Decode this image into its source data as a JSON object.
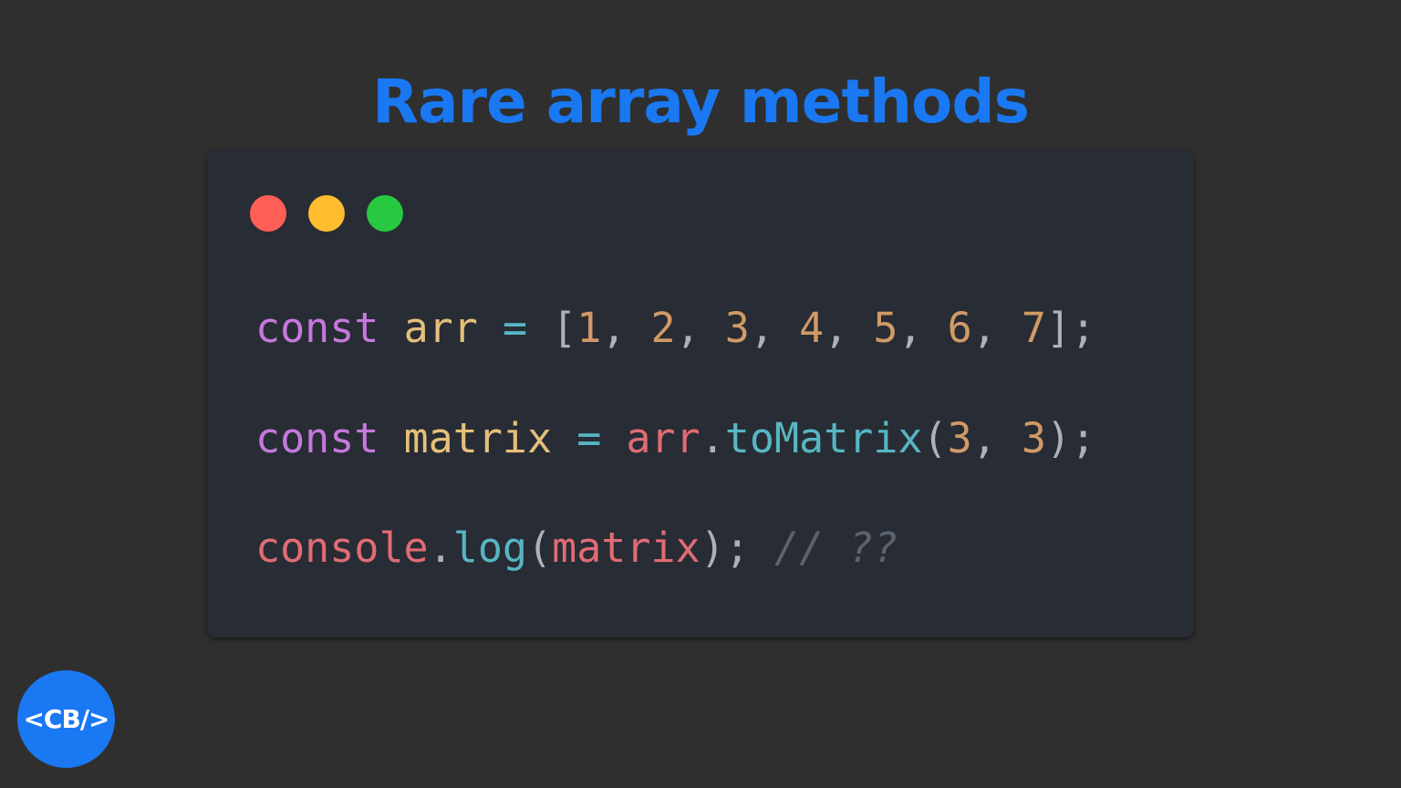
{
  "title": "Rare array methods",
  "logo": {
    "text": "<CB/>"
  },
  "window_controls": [
    "close",
    "minimize",
    "maximize"
  ],
  "code": {
    "lines": [
      [
        {
          "text": "const",
          "token": "keyword"
        },
        {
          "text": " ",
          "token": "plain"
        },
        {
          "text": "arr",
          "token": "variable"
        },
        {
          "text": " ",
          "token": "plain"
        },
        {
          "text": "=",
          "token": "operator"
        },
        {
          "text": " ",
          "token": "plain"
        },
        {
          "text": "[",
          "token": "punct"
        },
        {
          "text": "1",
          "token": "number"
        },
        {
          "text": ", ",
          "token": "punct"
        },
        {
          "text": "2",
          "token": "number"
        },
        {
          "text": ", ",
          "token": "punct"
        },
        {
          "text": "3",
          "token": "number"
        },
        {
          "text": ", ",
          "token": "punct"
        },
        {
          "text": "4",
          "token": "number"
        },
        {
          "text": ", ",
          "token": "punct"
        },
        {
          "text": "5",
          "token": "number"
        },
        {
          "text": ", ",
          "token": "punct"
        },
        {
          "text": "6",
          "token": "number"
        },
        {
          "text": ", ",
          "token": "punct"
        },
        {
          "text": "7",
          "token": "number"
        },
        {
          "text": "];",
          "token": "punct"
        }
      ],
      [
        {
          "text": "const",
          "token": "keyword"
        },
        {
          "text": " ",
          "token": "plain"
        },
        {
          "text": "matrix",
          "token": "variable"
        },
        {
          "text": " ",
          "token": "plain"
        },
        {
          "text": "=",
          "token": "operator"
        },
        {
          "text": " ",
          "token": "plain"
        },
        {
          "text": "arr",
          "token": "object"
        },
        {
          "text": ".",
          "token": "punct"
        },
        {
          "text": "toMatrix",
          "token": "method"
        },
        {
          "text": "(",
          "token": "punct"
        },
        {
          "text": "3",
          "token": "number"
        },
        {
          "text": ", ",
          "token": "punct"
        },
        {
          "text": "3",
          "token": "number"
        },
        {
          "text": ");",
          "token": "punct"
        }
      ],
      [
        {
          "text": "console",
          "token": "object"
        },
        {
          "text": ".",
          "token": "punct"
        },
        {
          "text": "log",
          "token": "method"
        },
        {
          "text": "(",
          "token": "punct"
        },
        {
          "text": "matrix",
          "token": "object"
        },
        {
          "text": ");",
          "token": "punct"
        },
        {
          "text": " ",
          "token": "plain"
        },
        {
          "text": "// ??",
          "token": "comment"
        }
      ]
    ]
  },
  "colors": {
    "background": "#2f2f2f",
    "window_bg": "#282c34",
    "title": "#1a78f2",
    "dot_red": "#ff5f57",
    "dot_yellow": "#febc2e",
    "dot_green": "#28c840",
    "logo_bg": "#1a78f2",
    "logo_text": "#ffffff",
    "keyword": "#c678dd",
    "variable": "#e5c07b",
    "operator": "#56b6c2",
    "number": "#d19a66",
    "punct": "#abb2bf",
    "object": "#e06c75",
    "method": "#56b6c2",
    "comment": "#5c6370",
    "plain": "#abb2bf"
  }
}
